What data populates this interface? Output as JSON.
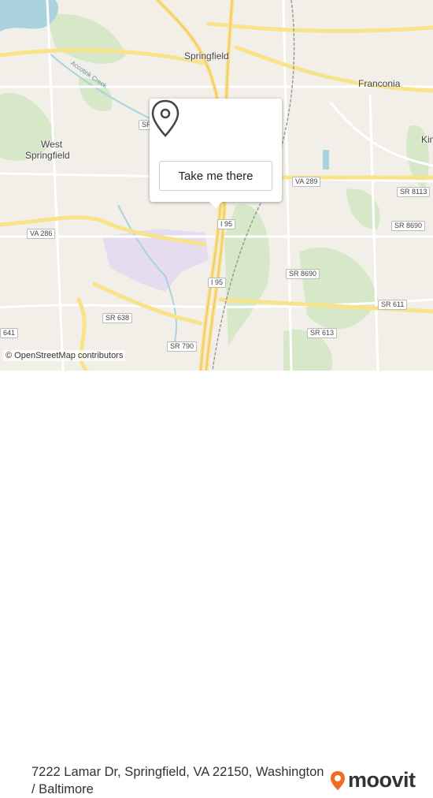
{
  "map": {
    "places": {
      "springfield": "Springfield",
      "franconia": "Franconia",
      "west": "West",
      "springfield_west": "Springfield",
      "kingstowne_partial": "Kin",
      "accotink_creek": "Accotink Creek"
    },
    "shields": {
      "i95_a": "I 95",
      "i95_b": "I 95",
      "va289": "VA 289",
      "va286": "VA 286",
      "sr8113": "SR 8113",
      "sr8690_a": "SR 8690",
      "sr8690_b": "SR 8690",
      "sr611": "SR 611",
      "sr613": "SR 613",
      "sr638": "SR 638",
      "sr790": "SR 790",
      "sr641": "641",
      "sr_partial": "SR"
    },
    "attribution": "© OpenStreetMap contributors"
  },
  "popup": {
    "pin_icon": "map-pin-icon",
    "button_label": "Take me there"
  },
  "footer": {
    "address": "7222 Lamar Dr, Springfield, VA 22150, Washington / Baltimore",
    "brand": "moovit",
    "brand_icon": "moovit-pin-icon",
    "brand_color": "#f26b23"
  }
}
